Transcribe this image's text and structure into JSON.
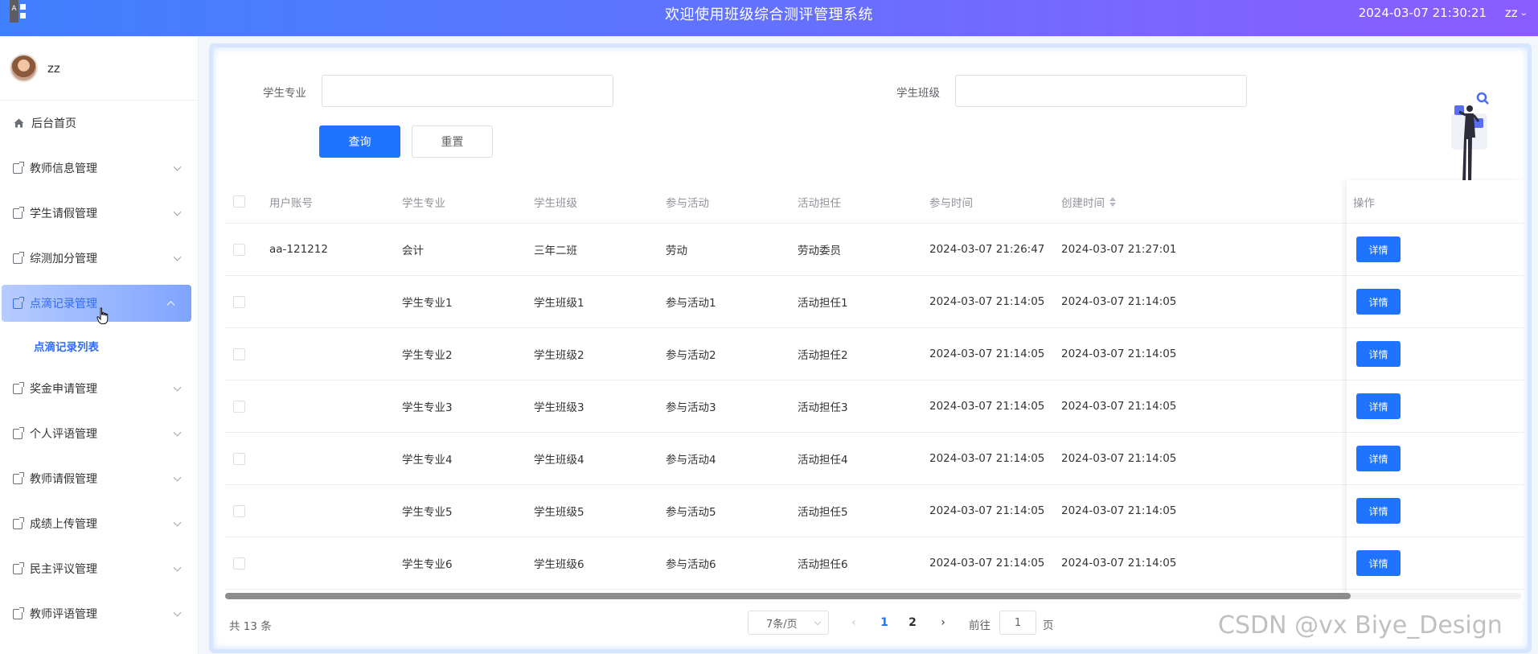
{
  "header": {
    "title": "欢迎使用班级综合测评管理系统",
    "datetime": "2024-03-07 21:30:21",
    "user": "zz",
    "logo_letter": "A"
  },
  "sidebar": {
    "username": "zz",
    "items": [
      {
        "label": "后台首页",
        "icon": "home-icon"
      },
      {
        "label": "教师信息管理",
        "icon": "document-icon"
      },
      {
        "label": "学生请假管理",
        "icon": "document-icon"
      },
      {
        "label": "综测加分管理",
        "icon": "document-icon"
      },
      {
        "label": "点滴记录管理",
        "icon": "document-icon",
        "active": true
      },
      {
        "label": "奖金申请管理",
        "icon": "document-icon"
      },
      {
        "label": "个人评语管理",
        "icon": "document-icon"
      },
      {
        "label": "教师请假管理",
        "icon": "document-icon"
      },
      {
        "label": "成绩上传管理",
        "icon": "document-icon"
      },
      {
        "label": "民主评议管理",
        "icon": "document-icon"
      },
      {
        "label": "教师评语管理",
        "icon": "document-icon"
      }
    ],
    "submenu": {
      "label": "点滴记录列表"
    }
  },
  "search": {
    "major_label": "学生专业",
    "major_value": "",
    "class_label": "学生班级",
    "class_value": "",
    "query_button": "查询",
    "reset_button": "重置"
  },
  "table": {
    "columns": [
      "用户账号",
      "学生专业",
      "学生班级",
      "参与活动",
      "活动担任",
      "参与时间",
      "创建时间",
      "操作"
    ],
    "action_label": "详情",
    "rows": [
      {
        "account": "aa-121212",
        "major": "会计",
        "class": "三年二班",
        "activity": "劳动",
        "role": "劳动委员",
        "join_time": "2024-03-07 21:26:47",
        "created": "2024-03-07 21:27:01"
      },
      {
        "account": "",
        "major": "学生专业1",
        "class": "学生班级1",
        "activity": "参与活动1",
        "role": "活动担任1",
        "join_time": "2024-03-07 21:14:05",
        "created": "2024-03-07 21:14:05"
      },
      {
        "account": "",
        "major": "学生专业2",
        "class": "学生班级2",
        "activity": "参与活动2",
        "role": "活动担任2",
        "join_time": "2024-03-07 21:14:05",
        "created": "2024-03-07 21:14:05"
      },
      {
        "account": "",
        "major": "学生专业3",
        "class": "学生班级3",
        "activity": "参与活动3",
        "role": "活动担任3",
        "join_time": "2024-03-07 21:14:05",
        "created": "2024-03-07 21:14:05"
      },
      {
        "account": "",
        "major": "学生专业4",
        "class": "学生班级4",
        "activity": "参与活动4",
        "role": "活动担任4",
        "join_time": "2024-03-07 21:14:05",
        "created": "2024-03-07 21:14:05"
      },
      {
        "account": "",
        "major": "学生专业5",
        "class": "学生班级5",
        "activity": "参与活动5",
        "role": "活动担任5",
        "join_time": "2024-03-07 21:14:05",
        "created": "2024-03-07 21:14:05"
      },
      {
        "account": "",
        "major": "学生专业6",
        "class": "学生班级6",
        "activity": "参与活动6",
        "role": "活动担任6",
        "join_time": "2024-03-07 21:14:05",
        "created": "2024-03-07 21:14:05"
      }
    ]
  },
  "pagination": {
    "total": "共 13 条",
    "page_size": "7条/页",
    "pages": [
      "1",
      "2"
    ],
    "current_page": "1",
    "goto_prefix": "前往",
    "goto_value": "1",
    "goto_suffix": "页",
    "prev_icon": "chevron-left-icon",
    "next_icon": "chevron-right-icon"
  },
  "watermark": "CSDN @vx  Biye_Design",
  "colors": {
    "primary": "#1e73ff",
    "header_gradient_start": "#3f80ff",
    "header_gradient_end": "#8a5cff",
    "active_menu_text": "#2f6df6"
  }
}
